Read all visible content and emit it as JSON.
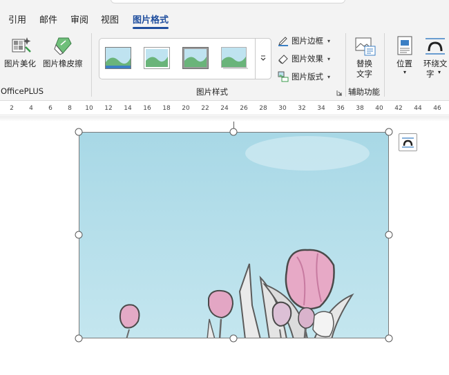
{
  "tabs": [
    {
      "label": "引用",
      "active": false
    },
    {
      "label": "邮件",
      "active": false
    },
    {
      "label": "审阅",
      "active": false
    },
    {
      "label": "视图",
      "active": false
    },
    {
      "label": "图片格式",
      "active": true
    }
  ],
  "ribbon": {
    "officeplus": {
      "group_label": "OfficePLUS",
      "beautify_label": "图片美化",
      "eraser_label": "图片橡皮擦"
    },
    "picture_styles": {
      "group_label": "图片样式",
      "thumbnails": [
        "style-1",
        "style-2",
        "style-3",
        "style-4"
      ],
      "border_label": "图片边框",
      "effects_label": "图片效果",
      "layout_label": "图片版式"
    },
    "accessibility": {
      "group_label": "辅助功能",
      "alt_text_line1": "替换",
      "alt_text_line2": "文字"
    },
    "arrange": {
      "position_label": "位置",
      "wrap_label_line1": "环绕文",
      "wrap_label_line2": "字"
    }
  },
  "ruler": {
    "ticks": [
      "2",
      "4",
      "6",
      "8",
      "10",
      "12",
      "14",
      "16",
      "18",
      "20",
      "22",
      "24",
      "26",
      "28",
      "30",
      "32",
      "34",
      "36",
      "38",
      "40",
      "42",
      "44",
      "46"
    ]
  },
  "colors": {
    "accent": "#1f4e9e",
    "sky": "#a9dbe8",
    "tulip": "#e7a9c6"
  }
}
